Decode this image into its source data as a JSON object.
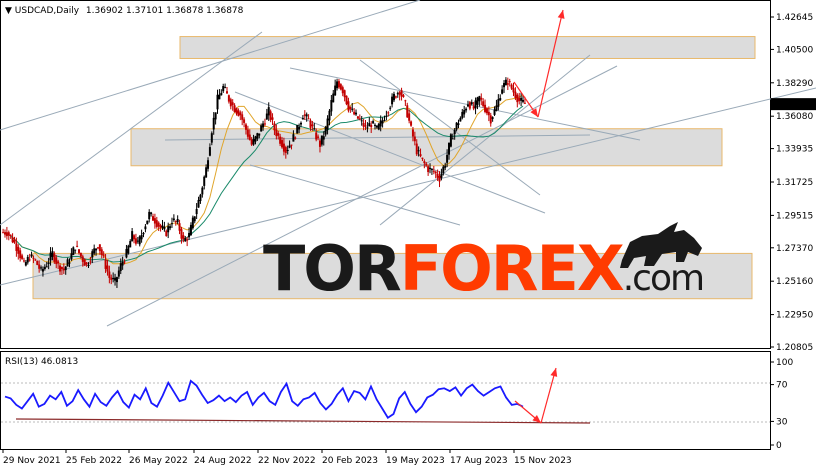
{
  "header": {
    "symbol_label": "USDCAD,Daily",
    "ohlc": "1.36902 1.37101 1.36878 1.36878"
  },
  "watermark": {
    "part1": "TOR",
    "part2": "FOREX",
    "part3": ".com",
    "color_dark": "#1a1a1a",
    "color_accent": "#ff3b00"
  },
  "chart_data": [
    {
      "type": "candlestick",
      "title": "USDCAD,Daily",
      "price_axis_ticks": [
        "1.42645",
        "1.40500",
        "1.38290",
        "1.36080",
        "1.33935",
        "1.31725",
        "1.29515",
        "1.27370",
        "1.25160",
        "1.22950",
        "1.20805"
      ],
      "current_price_label": "1.36878",
      "ylim": [
        1.20805,
        1.42645
      ],
      "x_tick_labels": [
        "29 Nov 2021",
        "25 Feb 2022",
        "26 May 2022",
        "24 Aug 2022",
        "22 Nov 2022",
        "20 Feb 2023",
        "19 May 2023",
        "17 Aug 2023",
        "15 Nov 2023"
      ],
      "series": [
        {
          "name": "close",
          "values": [
            1.284,
            1.279,
            1.272,
            1.262,
            1.268,
            1.265,
            1.258,
            1.263,
            1.27,
            1.262,
            1.259,
            1.266,
            1.275,
            1.268,
            1.262,
            1.27,
            1.276,
            1.266,
            1.254,
            1.251,
            1.262,
            1.27,
            1.282,
            1.276,
            1.286,
            1.296,
            1.292,
            1.287,
            1.284,
            1.292,
            1.29,
            1.278,
            1.282,
            1.296,
            1.309,
            1.326,
            1.352,
            1.372,
            1.38,
            1.372,
            1.366,
            1.362,
            1.352,
            1.342,
            1.348,
            1.356,
            1.364,
            1.352,
            1.345,
            1.338,
            1.344,
            1.352,
            1.362,
            1.358,
            1.35,
            1.342,
            1.352,
            1.37,
            1.384,
            1.378,
            1.367,
            1.362,
            1.358,
            1.353,
            1.356,
            1.352,
            1.358,
            1.366,
            1.374,
            1.378,
            1.368,
            1.352,
            1.338,
            1.331,
            1.326,
            1.324,
            1.32,
            1.33,
            1.346,
            1.355,
            1.362,
            1.37,
            1.366,
            1.373,
            1.366,
            1.359,
            1.367,
            1.38,
            1.384,
            1.377,
            1.371,
            1.369
          ]
        }
      ],
      "support_resistance_zones": [
        {
          "from": 1.399,
          "to": 1.4135
        },
        {
          "from": 1.328,
          "to": 1.3525
        },
        {
          "from": 1.24,
          "to": 1.27
        }
      ],
      "forecast_arrows": [
        "down to 1.3610",
        "up to 1.4280"
      ]
    },
    {
      "type": "line",
      "title": "RSI(13) 46.0813",
      "yticks": [
        "100",
        "70",
        "30",
        "0"
      ],
      "ylim": [
        0,
        100
      ],
      "levels": [
        70,
        30
      ],
      "series": [
        {
          "name": "RSI(13)",
          "values": [
            57,
            55,
            48,
            44,
            52,
            60,
            46,
            49,
            58,
            54,
            62,
            47,
            52,
            64,
            54,
            46,
            60,
            51,
            47,
            56,
            63,
            51,
            45,
            59,
            54,
            66,
            50,
            46,
            58,
            72,
            62,
            52,
            54,
            74,
            69,
            59,
            50,
            53,
            58,
            52,
            56,
            51,
            58,
            62,
            48,
            56,
            61,
            52,
            48,
            62,
            71,
            52,
            47,
            54,
            56,
            61,
            50,
            43,
            49,
            59,
            66,
            52,
            63,
            61,
            54,
            68,
            54,
            44,
            34,
            38,
            55,
            62,
            49,
            40,
            46,
            56,
            59,
            65,
            66,
            63,
            67,
            58,
            66,
            70,
            63,
            58,
            62,
            66,
            68,
            56,
            48,
            49,
            46
          ]
        }
      ],
      "current_value": 46.0813,
      "forecast_arrows": [
        "down to 30",
        "up to 78"
      ]
    }
  ],
  "colors": {
    "bull_candle": "#000000",
    "bear_candle": "#c20000",
    "ma_fast": "#e0a52a",
    "ma_slow": "#1a8a6a",
    "trend_line": "#9aaab8",
    "zone_fill": "#dcdcdc",
    "zone_border": "#e8b86b",
    "rsi_line": "#1a1aff",
    "arrow": "#ff2a2a"
  }
}
